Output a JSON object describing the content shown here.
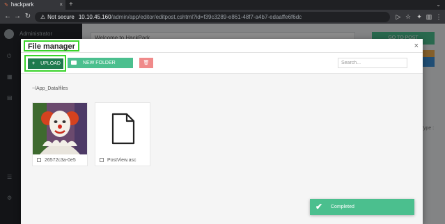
{
  "browser": {
    "tab_title": "hackpark",
    "not_secure_label": "Not secure",
    "url_host": "10.10.45.160",
    "url_path": "/admin/app/editor/editpost.cshtml?id=f39c3289-e861-48f7-a4b7-edaaffe6f6dc"
  },
  "admin_page": {
    "user_name": "Administrator",
    "post_title_value": "Welcome to HackPark",
    "goto_post_label": "GO TO POST",
    "type_label": "Type :"
  },
  "file_manager": {
    "title": "File manager",
    "upload_label": "UPLOAD",
    "new_folder_label": "NEW FOLDER",
    "search_placeholder": "Search...",
    "current_path": "~/App_Data/files",
    "files": [
      {
        "name": "26572c3a-0e5",
        "kind": "image-thumbnail"
      },
      {
        "name": "PostView.asc",
        "kind": "document-icon"
      }
    ]
  },
  "toast": {
    "message": "Completed",
    "color": "#4bbf8e"
  },
  "colors": {
    "accent_green": "#4bbf8e",
    "dark_green": "#1f7a4d",
    "danger": "#f08a8a",
    "highlight": "#39d32a"
  }
}
